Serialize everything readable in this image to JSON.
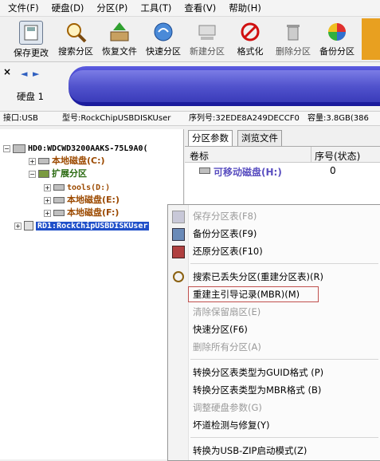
{
  "menubar": [
    "文件(F)",
    "硬盘(D)",
    "分区(P)",
    "工具(T)",
    "查看(V)",
    "帮助(H)"
  ],
  "toolbar": [
    {
      "label": "保存更改",
      "icon": "save-icon",
      "enabled": true
    },
    {
      "label": "搜索分区",
      "icon": "magnifier-icon",
      "enabled": true
    },
    {
      "label": "恢复文件",
      "icon": "recover-file-icon",
      "enabled": true
    },
    {
      "label": "快速分区",
      "icon": "quick-partition-icon",
      "enabled": true
    },
    {
      "label": "新建分区",
      "icon": "new-partition-icon",
      "enabled": false
    },
    {
      "label": "格式化",
      "icon": "format-icon",
      "enabled": true
    },
    {
      "label": "删除分区",
      "icon": "trash-icon",
      "enabled": false
    },
    {
      "label": "备份分区",
      "icon": "backup-icon",
      "enabled": true
    }
  ],
  "disk_nav": {
    "close": "×",
    "prev": "◄",
    "next": "►",
    "label": "硬盘 1"
  },
  "info": {
    "interface": "接口:USB",
    "model": "型号:RockChipUSBDISKUser",
    "serial": "序列号:32EDE8A249DECCF0",
    "capacity": "容量:3.8GB(386"
  },
  "tree": {
    "hd0": "HD0:WDCWD3200AAKS-75L9A0(",
    "local_c": "本地磁盘(C:)",
    "extended": "扩展分区",
    "tools_d": "tools(D:)",
    "local_e": "本地磁盘(E:)",
    "local_f": "本地磁盘(F:)",
    "rd1": "RD1:RockChipUSBDISKUser"
  },
  "tabs": [
    "分区参数",
    "浏览文件"
  ],
  "grid": {
    "col_label": "卷标",
    "col_seq": "序号(状态)",
    "row_label": "可移动磁盘(H:)",
    "row_seq": "0"
  },
  "context_menu": [
    {
      "label": "保存分区表(F8)",
      "enabled": false
    },
    {
      "label": "备份分区表(F9)",
      "enabled": true
    },
    {
      "label": "还原分区表(F10)",
      "enabled": true
    },
    {
      "label": "搜索已丢失分区(重建分区表)(R)",
      "enabled": true
    },
    {
      "label": "重建主引导记录(MBR)(M)",
      "enabled": true,
      "highlighted": true
    },
    {
      "label": "清除保留扇区(E)",
      "enabled": false
    },
    {
      "label": "快速分区(F6)",
      "enabled": true
    },
    {
      "label": "删除所有分区(A)",
      "enabled": false
    },
    {
      "label": "转换分区表类型为GUID格式 (P)",
      "enabled": true
    },
    {
      "label": "转换分区表类型为MBR格式 (B)",
      "enabled": true
    },
    {
      "label": "调整硬盘参数(G)",
      "enabled": false
    },
    {
      "label": "坏道检测与修复(Y)",
      "enabled": true
    },
    {
      "label": "转换为USB-ZIP启动模式(Z)",
      "enabled": true
    }
  ],
  "colors": {
    "highlight_border": "#c0504d",
    "disabled_text": "#9a9a9a",
    "partition_text": "#9c4a00",
    "rd1_bg": "#1f4fc9"
  }
}
